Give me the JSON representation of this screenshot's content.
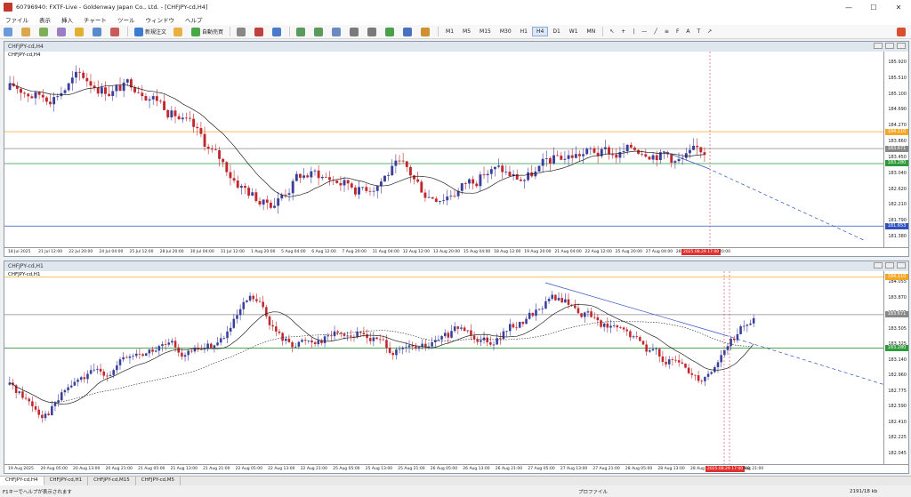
{
  "window": {
    "title": "60796940: FXTF-Live - Goldenway Japan Co., Ltd. - [CHFJPY-cd,H4]",
    "minimize": "—",
    "maximize": "☐",
    "close": "✕"
  },
  "menu": {
    "items": [
      "ファイル",
      "表示",
      "挿入",
      "チャート",
      "ツール",
      "ウィンドウ",
      "ヘルプ"
    ]
  },
  "toolbar": {
    "new_order": "新規注文",
    "auto_trading": "自動売買",
    "timeframes": [
      "M1",
      "M5",
      "M15",
      "M30",
      "H1",
      "H4",
      "D1",
      "W1",
      "MN"
    ],
    "active_timeframe": "H4"
  },
  "chart1": {
    "window_title": "CHFJPY-cd,H4",
    "label": "CHFJPY-cd,H4",
    "price_levels": [
      "185.920",
      "185.510",
      "185.100",
      "184.690",
      "184.270",
      "183.860",
      "183.450",
      "183.040",
      "182.620",
      "182.210",
      "181.790",
      "181.380"
    ],
    "badge_orange": "184.110",
    "badge_gray": "183.671",
    "badge_green": "183.280",
    "badge_blue": "181.653",
    "time_labels": [
      "18 Jul 2025",
      "21 Jul 12:00",
      "22 Jul 20:00",
      "24 Jul 04:00",
      "25 Jul 12:00",
      "28 Jul 20:00",
      "30 Jul 04:00",
      "31 Jul 12:00",
      "1 Aug 20:00",
      "5 Aug 04:00",
      "6 Aug 12:00",
      "7 Aug 20:00",
      "11 Aug 04:00",
      "12 Aug 12:00",
      "13 Aug 20:00",
      "15 Aug 04:00",
      "18 Aug 12:00",
      "19 Aug 20:00",
      "21 Aug 04:00",
      "22 Aug 12:00",
      "25 Aug 20:00",
      "27 Aug 04:00",
      "28"
    ],
    "time_badge": "2025.08.29 17:00",
    "time_tail": "20:00"
  },
  "chart2": {
    "window_title": "CHFJPY-cd,H1",
    "label": "CHFJPY-cd,H1",
    "price_levels": [
      "184.055",
      "183.870",
      "183.685",
      "183.505",
      "183.325",
      "183.140",
      "182.960",
      "182.775",
      "182.590",
      "182.410",
      "182.225",
      "182.045"
    ],
    "badge_orange": "184.110",
    "badge_gray": "183.671",
    "badge_green": "183.280",
    "time_labels": [
      "19 Aug 2025",
      "20 Aug 05:00",
      "20 Aug 13:00",
      "20 Aug 21:00",
      "21 Aug 05:00",
      "21 Aug 13:00",
      "21 Aug 21:00",
      "22 Aug 05:00",
      "22 Aug 13:00",
      "22 Aug 21:00",
      "25 Aug 05:00",
      "25 Aug 13:00",
      "25 Aug 21:00",
      "26 Aug 05:00",
      "26 Aug 13:00",
      "26 Aug 21:00",
      "27 Aug 05:00",
      "27 Aug 13:00",
      "27 Aug 21:00",
      "28 Aug 05:00",
      "28 Aug 13:00",
      "28 Aug 21:00",
      "29 Aug 05:00"
    ],
    "time_badge": "2025.08.29 17:00",
    "time_tail": "Aug 21:00"
  },
  "tabs": [
    "CHFJPY-cd,H4",
    "CHFJPY-cd,H1",
    "CHFJPY-cd,M15",
    "CHFJPY-cd,M5"
  ],
  "status": {
    "help": "F1キーでヘルプが表示されます",
    "profile": "プロファイル",
    "traffic": "2191/18 kb"
  },
  "colors": {
    "bull": "#3a3f9a",
    "bear": "#c0282d",
    "orange_line": "#f5a623",
    "green_line": "#2e9b3a",
    "blue_line": "#3050c0",
    "ma": "#222222"
  }
}
